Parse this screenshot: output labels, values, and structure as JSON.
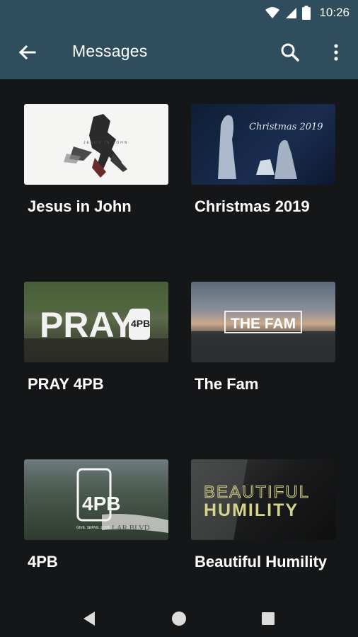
{
  "status_bar": {
    "time": "10:26",
    "icons": [
      "wifi-icon",
      "signal-icon",
      "battery-icon"
    ]
  },
  "app_bar": {
    "title": "Messages",
    "background": "#2f4d5c",
    "icons": [
      "back-arrow-icon",
      "search-icon",
      "more-vert-icon"
    ]
  },
  "messages": [
    {
      "title": "Jesus in John",
      "thumb_text": "JESUS   IN JOHN"
    },
    {
      "title": "Christmas 2019",
      "thumb_text": "Christmas 2019"
    },
    {
      "title": "PRAY 4PB",
      "thumb_text": "PRAY",
      "thumb_badge": "4PB"
    },
    {
      "title": "The Fam",
      "thumb_text": "THE FAM"
    },
    {
      "title": "4PB",
      "thumb_text": "4PB",
      "thumb_sub": "GIVE. SERVE. LOVE.",
      "thumb_bottom": "LAR BLVD"
    },
    {
      "title": "Beautiful Humility",
      "thumb_text_line1": "BEAUTIFUL",
      "thumb_text_line2": "HUMILITY"
    }
  ],
  "nav_bar": {
    "icons": [
      "back-triangle-icon",
      "home-circle-icon",
      "recents-square-icon"
    ]
  }
}
